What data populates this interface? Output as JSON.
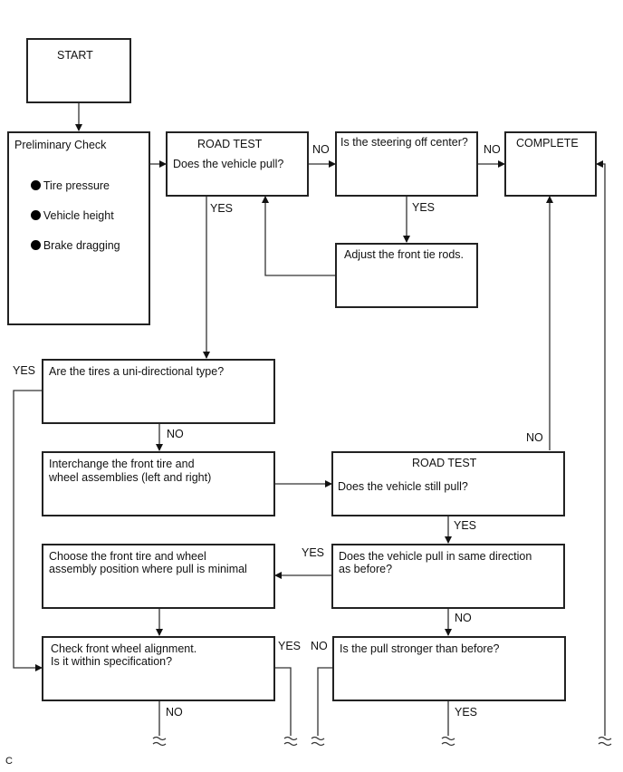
{
  "diagram": {
    "nodes": {
      "start": {
        "label": "START"
      },
      "preliminary": {
        "title": "Preliminary Check",
        "items": [
          "Tire pressure",
          "Vehicle height",
          "Brake dragging"
        ]
      },
      "road_test_1": {
        "title": "ROAD TEST",
        "question": "Does the vehicle pull?"
      },
      "steering_off_center": {
        "question": "Is the steering off center?"
      },
      "complete": {
        "label": "COMPLETE"
      },
      "adjust_tie_rods": {
        "label": "Adjust the front tie rods."
      },
      "uni_directional": {
        "question": "Are the tires a uni-directional type?"
      },
      "interchange": {
        "line1": "Interchange the front tire and",
        "line2": "wheel assemblies (left and right)"
      },
      "road_test_2": {
        "title": "ROAD TEST",
        "question": "Does the vehicle still pull?"
      },
      "choose_position": {
        "line1": "Choose the front tire and wheel",
        "line2": "assembly position where pull is minimal"
      },
      "same_direction": {
        "line1": "Does the vehicle pull in same direction",
        "line2": "as before?"
      },
      "check_alignment": {
        "line1": "Check front wheel alignment.",
        "line2": "Is it within specification?"
      },
      "pull_stronger": {
        "question": "Is the pull stronger than before?"
      }
    },
    "edge_labels": {
      "rt1_no": "NO",
      "rt1_yes": "YES",
      "steer_no": "NO",
      "steer_yes": "YES",
      "uni_yes": "YES",
      "uni_no": "NO",
      "rt2_no": "NO",
      "rt2_yes": "YES",
      "same_yes": "YES",
      "same_no": "NO",
      "align_yes": "YES",
      "align_no": "NO",
      "stronger_no": "NO",
      "stronger_yes": "YES"
    },
    "figure_code": "C"
  }
}
